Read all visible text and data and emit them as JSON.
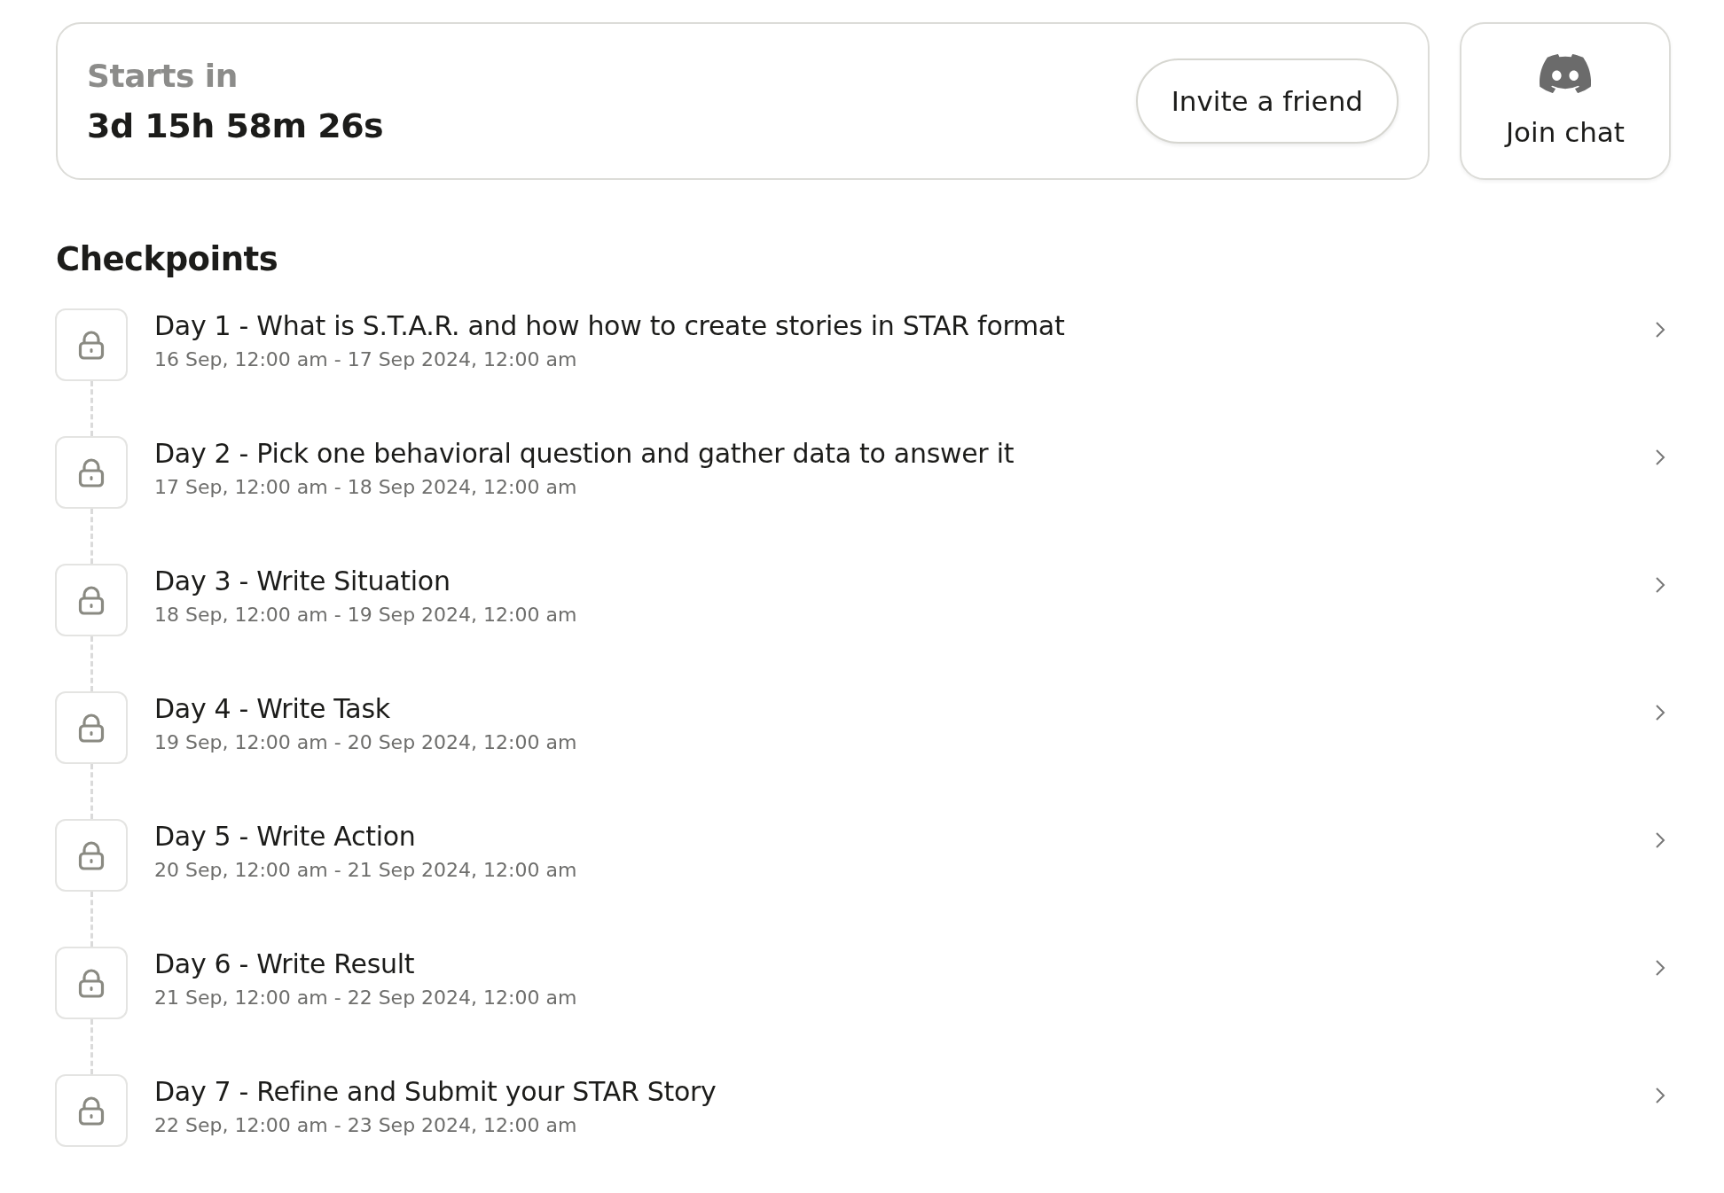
{
  "countdown": {
    "label": "Starts in",
    "value": "3d 15h 58m 26s",
    "button": "Invite a friend"
  },
  "chat": {
    "label": "Join chat"
  },
  "checkpoints": {
    "title": "Checkpoints",
    "items": [
      {
        "title": "Day 1 - What is S.T.A.R. and how how to create stories in STAR format",
        "dates": "16 Sep, 12:00 am - 17 Sep 2024, 12:00 am",
        "locked": true
      },
      {
        "title": "Day 2 - Pick one behavioral question and gather data to answer it",
        "dates": "17 Sep, 12:00 am - 18 Sep 2024, 12:00 am",
        "locked": true
      },
      {
        "title": "Day 3 - Write Situation",
        "dates": "18 Sep, 12:00 am - 19 Sep 2024, 12:00 am",
        "locked": true
      },
      {
        "title": "Day 4 - Write Task",
        "dates": "19 Sep, 12:00 am - 20 Sep 2024, 12:00 am",
        "locked": true
      },
      {
        "title": "Day 5 - Write Action",
        "dates": "20 Sep, 12:00 am - 21 Sep 2024, 12:00 am",
        "locked": true
      },
      {
        "title": "Day 6 - Write Result",
        "dates": "21 Sep, 12:00 am - 22 Sep 2024, 12:00 am",
        "locked": true
      },
      {
        "title": "Day 7 - Refine and Submit your STAR Story",
        "dates": "22 Sep, 12:00 am - 23 Sep 2024, 12:00 am",
        "locked": true
      }
    ]
  }
}
